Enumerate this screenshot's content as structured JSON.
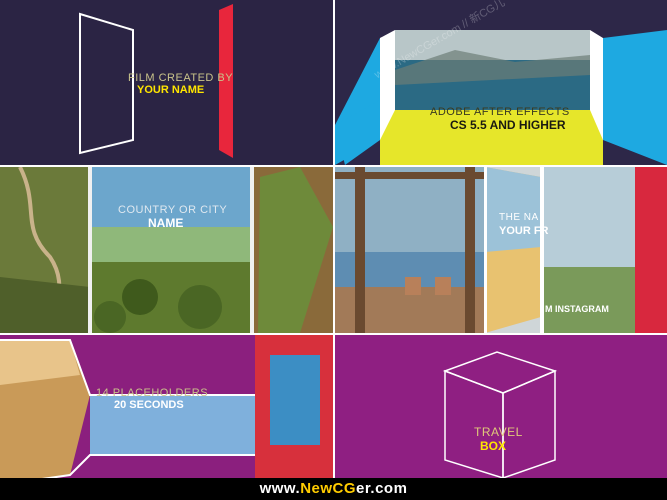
{
  "panels": {
    "p1": {
      "line1": "FILM CREATED BY",
      "line2": "YOUR NAME",
      "accent": "#e8263c",
      "text_color_thin": "#c9c38a",
      "text_color_bold": "#ffe600"
    },
    "p2": {
      "line1": "ADOBE AFTER EFFECTS",
      "line2": "CS 5.5 AND HIGHER",
      "colors": {
        "blue": "#1ea9e1",
        "yellow": "#e6e62a"
      }
    },
    "p3": {
      "line1": "COUNTRY OR CITY",
      "line2": "NAME"
    },
    "p4": {
      "line1": "THE NA",
      "line2": "YOUR FR",
      "line3": "M INSTAGRAM"
    },
    "p5": {
      "line1": "14 PLACEHOLDERS",
      "line2": "20 SECONDS",
      "bg": "#8b1f7e"
    },
    "p6": {
      "line1": "TRAVEL",
      "line2": "BOX",
      "bg": "#8f1f82"
    }
  },
  "watermark": {
    "text": "www.NewCGer.com // 新CG儿"
  },
  "footer": {
    "prefix": "www.",
    "mid": "NewCG",
    "suffix": "er.com"
  }
}
